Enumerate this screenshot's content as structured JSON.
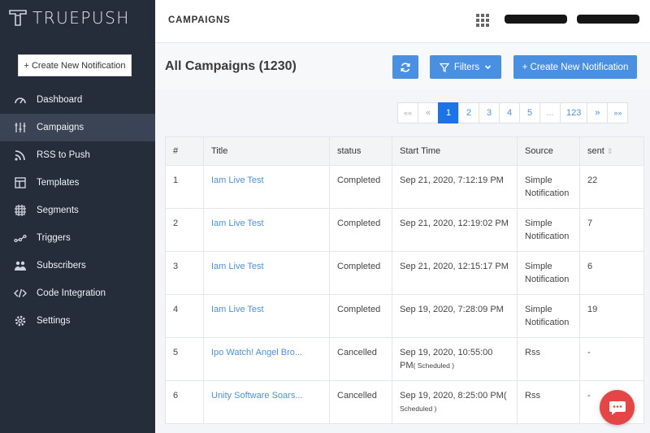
{
  "brand": {
    "name": "TRUEPUSH"
  },
  "sidebar": {
    "create_label": "+ Create New Notification",
    "items": [
      {
        "label": "Dashboard",
        "icon": "gauge-icon"
      },
      {
        "label": "Campaigns",
        "icon": "sliders-icon",
        "active": true
      },
      {
        "label": "RSS to Push",
        "icon": "rss-icon"
      },
      {
        "label": "Templates",
        "icon": "template-icon"
      },
      {
        "label": "Segments",
        "icon": "segments-icon"
      },
      {
        "label": "Triggers",
        "icon": "triggers-icon"
      },
      {
        "label": "Subscribers",
        "icon": "subscribers-icon"
      },
      {
        "label": "Code Integration",
        "icon": "code-icon"
      },
      {
        "label": "Settings",
        "icon": "gear-icon"
      }
    ]
  },
  "topbar": {
    "title": "CAMPAIGNS"
  },
  "header": {
    "title": "All Campaigns (1230)",
    "filters_label": "Filters",
    "create_label": "+ Create New Notification"
  },
  "pagination": {
    "first": "««",
    "prev": "«",
    "pages": [
      "1",
      "2",
      "3",
      "4",
      "5"
    ],
    "ellipsis": "...",
    "last_page": "123",
    "next": "»",
    "last": "»»",
    "current": "1"
  },
  "table": {
    "headers": {
      "num": "#",
      "title": "Title",
      "status": "status",
      "start": "Start Time",
      "source": "Source",
      "sent": "sent"
    },
    "rows": [
      {
        "num": "1",
        "title": "Iam Live Test",
        "status": "Completed",
        "start": "Sep 21, 2020, 7:12:19 PM",
        "scheduled": "",
        "source": "Simple Notification",
        "sent": "22"
      },
      {
        "num": "2",
        "title": "Iam Live Test",
        "status": "Completed",
        "start": "Sep 21, 2020, 12:19:02 PM",
        "scheduled": "",
        "source": "Simple Notification",
        "sent": "7"
      },
      {
        "num": "3",
        "title": "Iam Live Test",
        "status": "Completed",
        "start": "Sep 21, 2020, 12:15:17 PM",
        "scheduled": "",
        "source": "Simple Notification",
        "sent": "6"
      },
      {
        "num": "4",
        "title": "Iam Live Test",
        "status": "Completed",
        "start": "Sep 19, 2020, 7:28:09 PM",
        "scheduled": "",
        "source": "Simple Notification",
        "sent": "19"
      },
      {
        "num": "5",
        "title": "Ipo Watch! Angel Bro...",
        "status": "Cancelled",
        "start": "Sep 19, 2020, 10:55:00 PM",
        "scheduled": "( Scheduled )",
        "source": "Rss",
        "sent": "-"
      },
      {
        "num": "6",
        "title": "Unity Software Soars...",
        "status": "Cancelled",
        "start": "Sep 19, 2020, 8:25:00 PM(",
        "scheduled": "Scheduled )",
        "source": "Rss",
        "sent": "-"
      }
    ]
  },
  "colors": {
    "sidebar": "#252c3a",
    "accent": "#4a90e2",
    "completed": "#3d9a3d",
    "chat": "#e64545"
  }
}
